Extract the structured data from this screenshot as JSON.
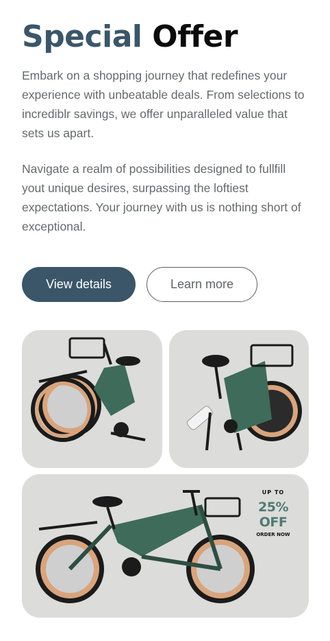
{
  "heading": {
    "word1": "Special",
    "word2": "Offer"
  },
  "paragraphs": [
    "Embark on a shopping journey that redefines your experience with unbeatable deals. From selections to incrediblr savings, we offer unparalleled value that sets us apart.",
    "Navigate a realm of possibilities designed to fullfill yout unique desires, surpassing the loftiest expectations. Your journey with us is nothing short of exceptional."
  ],
  "buttons": {
    "primary": "View details",
    "secondary": "Learn more"
  },
  "promo": {
    "up_to": "UP TO",
    "discount": "25% OFF",
    "order": "ORDER NOW"
  },
  "colors": {
    "accent": "#3b5668",
    "card_bg": "#dcdcdb",
    "frame": "#3f6b5a",
    "tire_wall": "#d9a47d"
  }
}
